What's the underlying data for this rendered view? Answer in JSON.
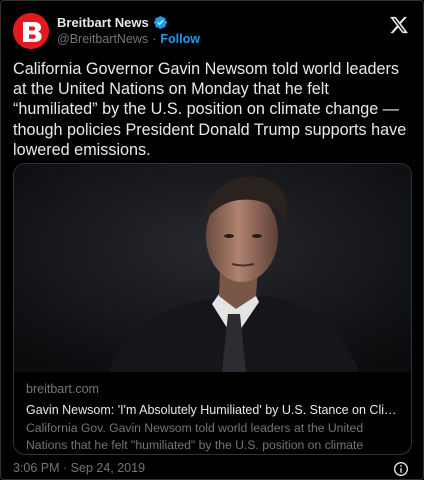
{
  "account": {
    "display_name": "Breitbart News",
    "handle": "@BreitbartNews",
    "separator": "·",
    "follow_label": "Follow"
  },
  "tweet": {
    "text": "California Governor Gavin Newsom told world leaders at the United Nations on Monday that he felt “humiliated” by the U.S. position on climate change — though policies President Donald Trump supports have lowered emissions."
  },
  "link_card": {
    "domain": "breitbart.com",
    "title": "Gavin Newsom: 'I'm Absolutely Humiliated' by U.S. Stance on Climate ...",
    "description": "California Gov. Gavin Newsom told world leaders at the United Nations that he felt \"humiliated\" by the U.S. position on climate change."
  },
  "footer": {
    "timestamp": "3:06 PM · Sep 24, 2019"
  },
  "icons": {
    "avatar": "breitbart-logo-icon",
    "verified": "verified-badge-icon",
    "platform": "x-logo-icon",
    "info": "info-icon"
  },
  "colors": {
    "background": "#000000",
    "text_primary": "#e7e9ea",
    "text_secondary": "#71767b",
    "accent": "#1d9bf0",
    "brand_red": "#e11a22"
  }
}
